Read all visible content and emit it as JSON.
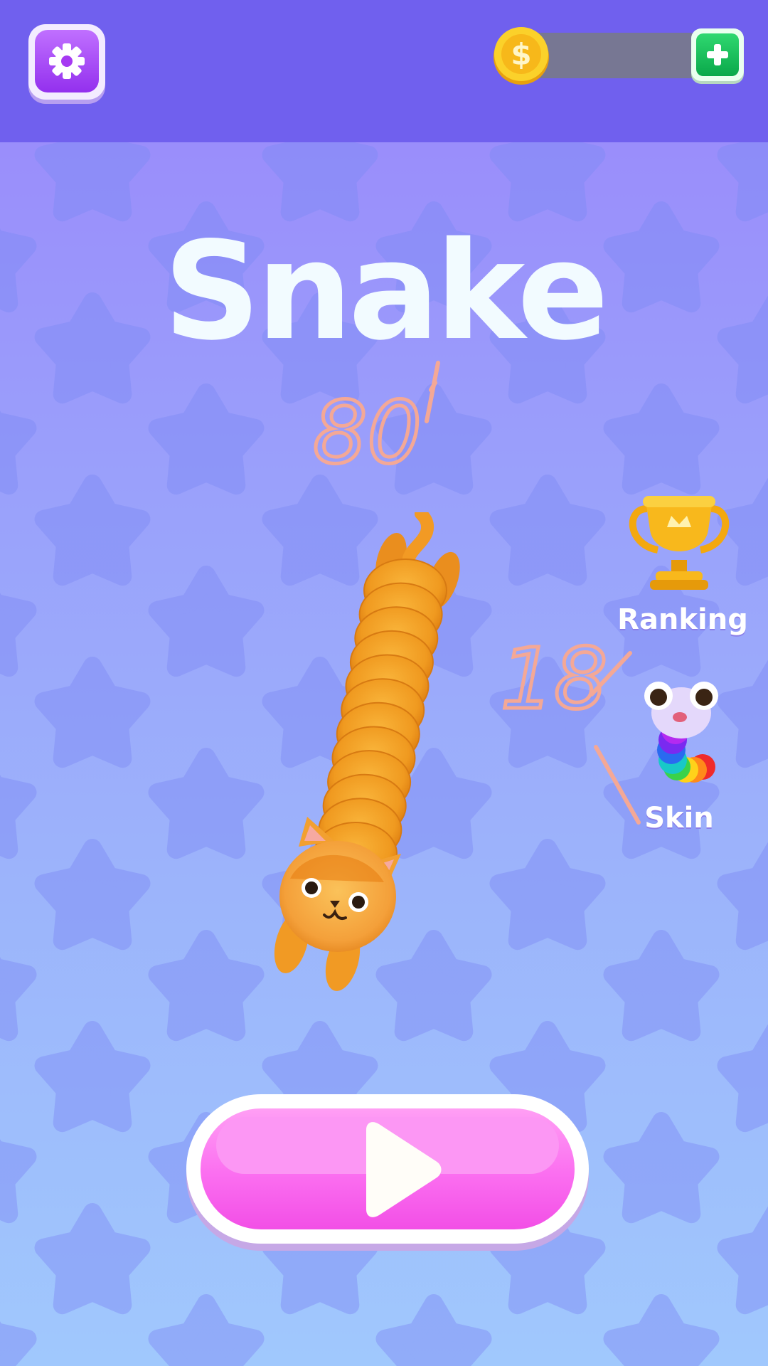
{
  "game": {
    "title": "Snake",
    "mode": "main-menu"
  },
  "hud": {
    "coins": "",
    "settings_icon": "gear-icon",
    "coin_icon": "dollar-coin-icon",
    "add_coins_icon": "plus-icon"
  },
  "menu": {
    "ranking_label": "Ranking",
    "ranking_icon": "trophy-icon",
    "skin_label": "Skin",
    "skin_icon": "rainbow-worm-icon",
    "play_icon": "play-icon"
  },
  "player_snake": {
    "skin": "orange-cat"
  },
  "handwritten_marks": {
    "upper": "80",
    "lower": "18"
  },
  "colors": {
    "topbar": "#7060ee",
    "title": "#f2fbff",
    "play_button": "#fb6ef0",
    "coin": "#fbc318",
    "plus_button": "#0aa84a",
    "settings_button": "#9330ee",
    "handwriting": "#f4a896"
  }
}
